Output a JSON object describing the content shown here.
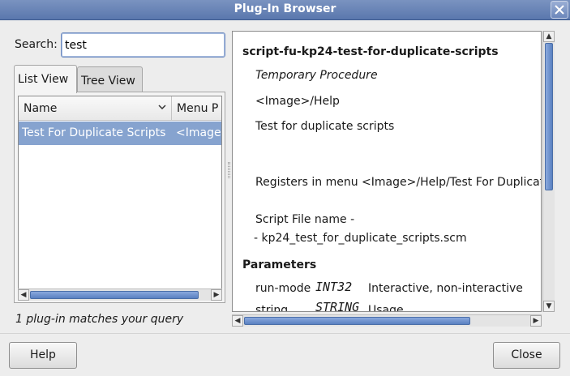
{
  "window": {
    "title": "Plug-In Browser"
  },
  "search": {
    "label": "Search:",
    "value": "test"
  },
  "tabs": {
    "list_view": "List View",
    "tree_view": "Tree View"
  },
  "list": {
    "columns": {
      "name": "Name",
      "menu_path": "Menu P"
    },
    "rows": [
      {
        "name": "Test For Duplicate Scripts",
        "menu_path": "<Image>"
      }
    ]
  },
  "status": "1 plug-in matches your query",
  "detail": {
    "procedure_name": "script-fu-kp24-test-for-duplicate-scripts",
    "type": "Temporary Procedure",
    "menu": "<Image>/Help",
    "blurb": "Test for duplicate scripts",
    "help": "Registers in menu <Image>/Help/Test For Duplicat",
    "script_file_label": "Script File name -",
    "script_file": "- kp24_test_for_duplicate_scripts.scm",
    "parameters_heading": "Parameters",
    "parameters": [
      {
        "name": "run-mode",
        "type": "INT32",
        "description": "Interactive, non-interactive"
      },
      {
        "name": "string",
        "type": "STRING",
        "description": "Usage"
      }
    ]
  },
  "buttons": {
    "help": "Help",
    "close": "Close"
  },
  "colors": {
    "titlebar": "#5a77ad",
    "selection": "#86a3cf",
    "scroll_thumb": "#5a81c1"
  },
  "icons": {
    "close": "close-icon",
    "sort": "chevron-down-icon"
  }
}
